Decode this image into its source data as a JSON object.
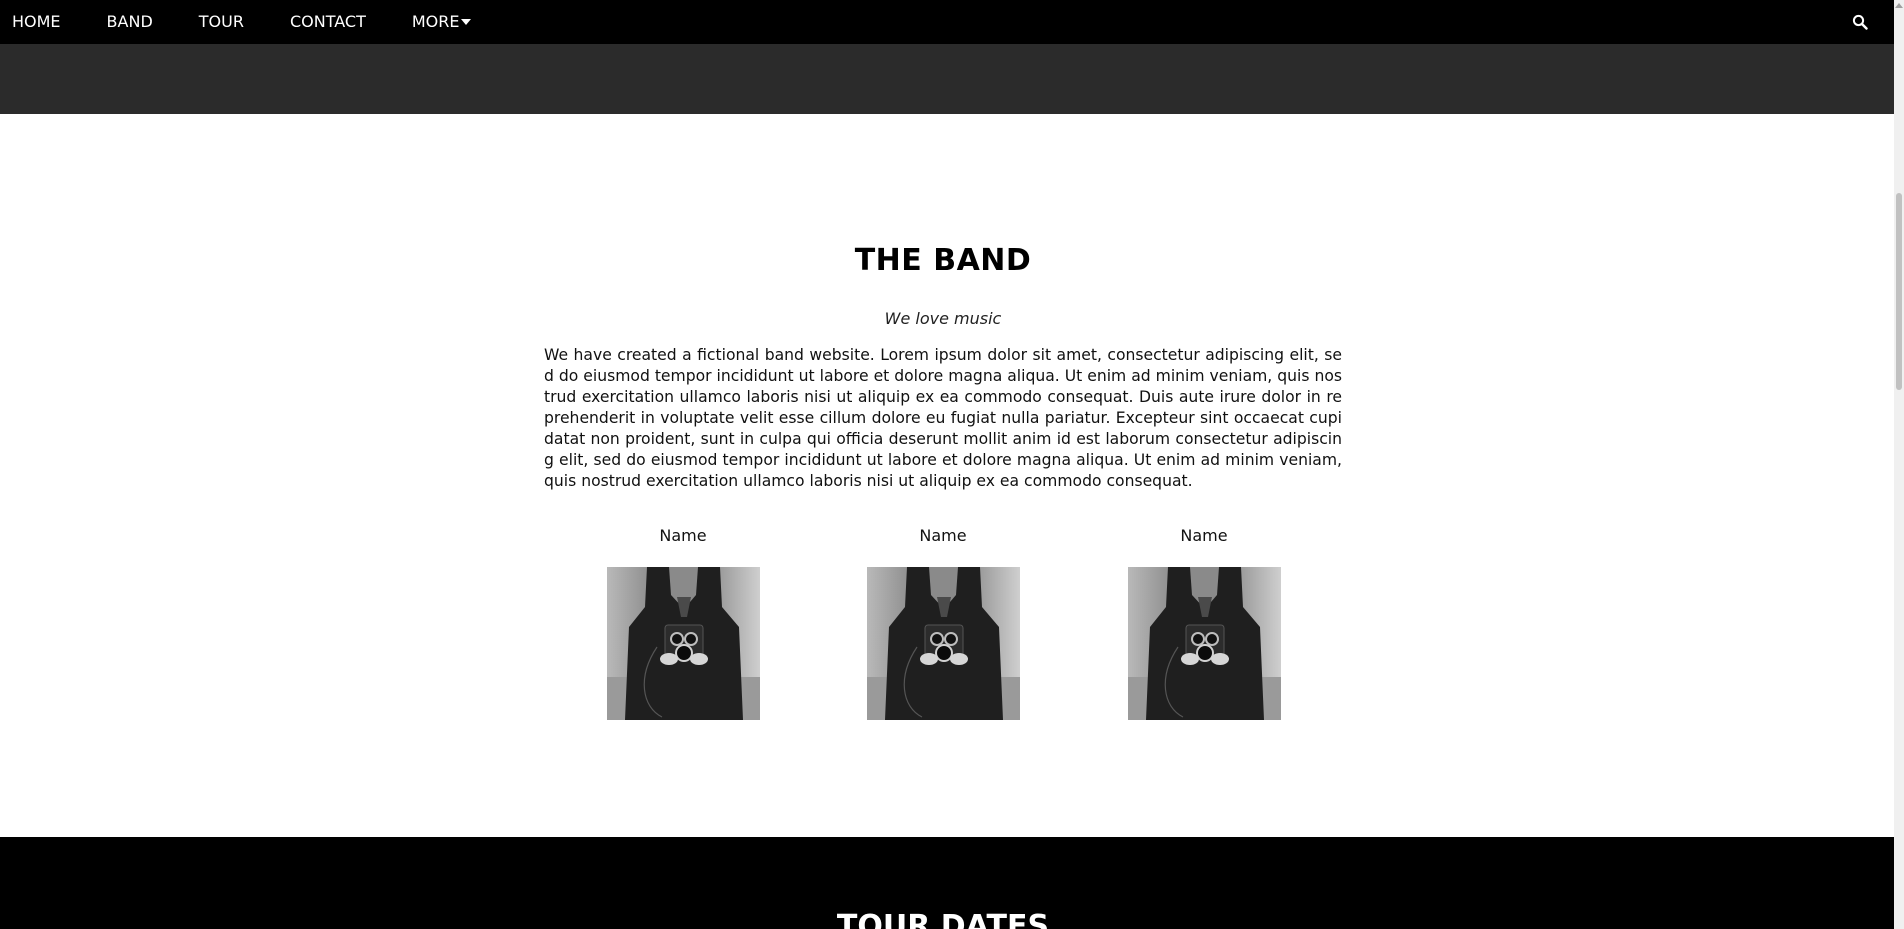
{
  "nav": {
    "items": [
      {
        "label": "HOME"
      },
      {
        "label": "BAND"
      },
      {
        "label": "TOUR"
      },
      {
        "label": "CONTACT"
      },
      {
        "label": "MORE"
      }
    ],
    "search_icon": "search-icon"
  },
  "band": {
    "title": "THE BAND",
    "tagline": "We love music",
    "description": "We have created a fictional band website. Lorem ipsum dolor sit amet, consectetur adipiscing elit, sed do eiusmod tempor incididunt ut labore et dolore magna aliqua. Ut enim ad minim veniam, quis nostrud exercitation ullamco laboris nisi ut aliquip ex ea commodo consequat. Duis aute irure dolor in reprehenderit in voluptate velit esse cillum dolore eu fugiat nulla pariatur. Excepteur sint occaecat cupidatat non proident, sunt in culpa qui officia deserunt mollit anim id est laborum consectetur adipiscing elit, sed do eiusmod tempor incididunt ut labore et dolore magna aliqua. Ut enim ad minim veniam, quis nostrud exercitation ullamco laboris nisi ut aliquip ex ea commodo consequat.",
    "members": [
      {
        "name": "Name"
      },
      {
        "name": "Name"
      },
      {
        "name": "Name"
      }
    ]
  },
  "tour": {
    "title": "TOUR DATES"
  },
  "colors": {
    "nav_bg": "#000000",
    "hero_strip": "#2b2b2b",
    "tour_bg": "#000000"
  }
}
